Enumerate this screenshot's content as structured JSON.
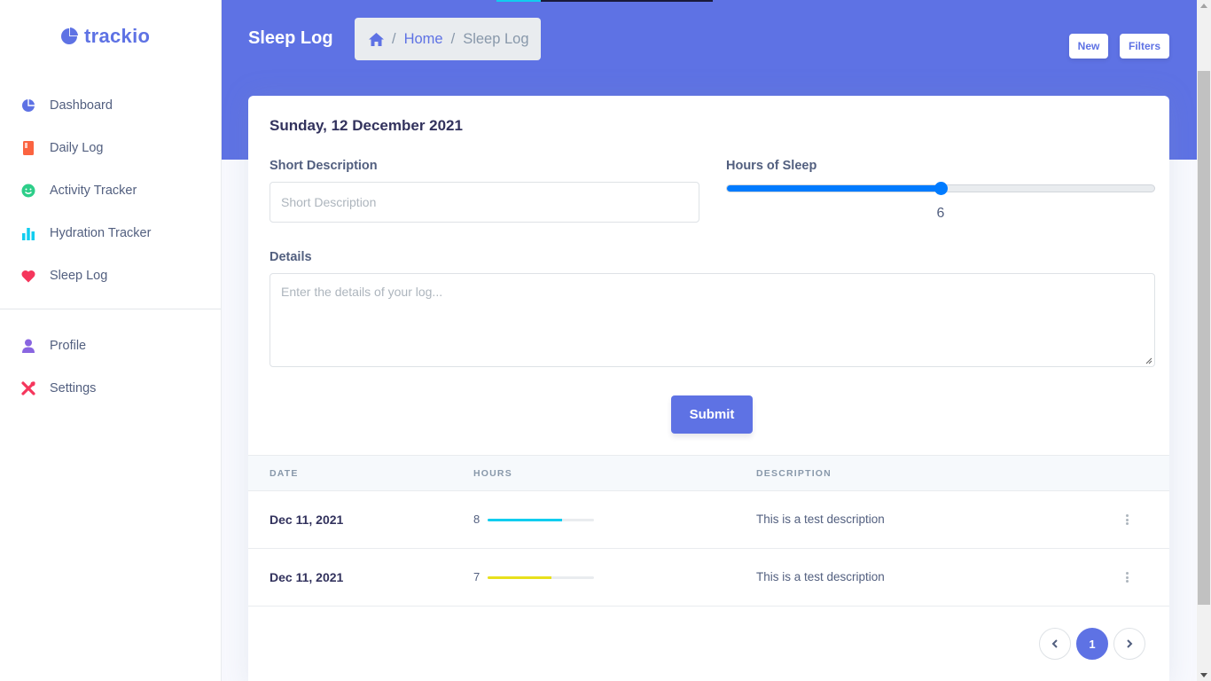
{
  "brand": {
    "name": "trackio",
    "icon": "pie-chart-icon"
  },
  "sidebar": {
    "items": [
      {
        "label": "Dashboard",
        "icon": "pie-chart-icon",
        "color": "#5e72e4"
      },
      {
        "label": "Daily Log",
        "icon": "book-icon",
        "color": "#fb6340"
      },
      {
        "label": "Activity Tracker",
        "icon": "smile-icon",
        "color": "#2dce89"
      },
      {
        "label": "Hydration Tracker",
        "icon": "bar-chart-icon",
        "color": "#11cdef"
      },
      {
        "label": "Sleep Log",
        "icon": "heart-icon",
        "color": "#f5365c"
      }
    ],
    "secondary_items": [
      {
        "label": "Profile",
        "icon": "user-icon",
        "color": "#8965e0"
      },
      {
        "label": "Settings",
        "icon": "tools-icon",
        "color": "#f5365c"
      }
    ]
  },
  "header": {
    "title": "Sleep Log",
    "breadcrumb": {
      "home_icon": "home-icon",
      "home": "Home",
      "current": "Sleep Log"
    },
    "buttons": {
      "new": "New",
      "filters": "Filters"
    }
  },
  "form": {
    "date": "Sunday, 12 December 2021",
    "short_description": {
      "label": "Short Description",
      "placeholder": "Short Description",
      "value": ""
    },
    "hours": {
      "label": "Hours of Sleep",
      "value": "6",
      "min": 0,
      "max": 12
    },
    "details": {
      "label": "Details",
      "placeholder": "Enter the details of your log...",
      "value": ""
    },
    "submit": "Submit"
  },
  "table": {
    "columns": [
      "DATE",
      "HOURS",
      "DESCRIPTION"
    ],
    "rows": [
      {
        "date": "Dec 11, 2021",
        "hours": "8",
        "progress_percent": 70,
        "bar_color": "#11cdef",
        "description": "This is a test description"
      },
      {
        "date": "Dec 11, 2021",
        "hours": "7",
        "progress_percent": 60,
        "bar_color": "#e8e01c",
        "description": "This is a test description"
      }
    ]
  },
  "pagination": {
    "current": "1"
  },
  "colors": {
    "primary": "#5e72e4",
    "slider": "#007bff"
  }
}
